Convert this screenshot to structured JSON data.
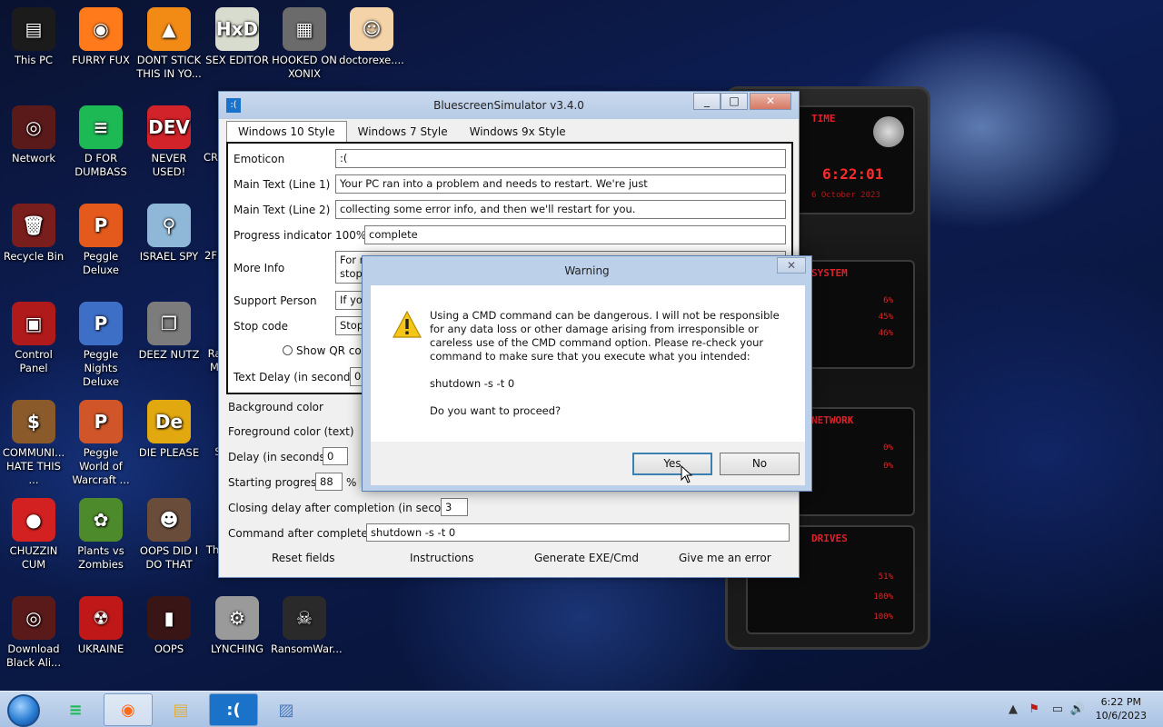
{
  "desktop": {
    "icons": [
      {
        "label": "This PC",
        "bg": "#1b1b1b",
        "glyph": "▤"
      },
      {
        "label": "FURRY FUX",
        "bg": "#ff7a1a",
        "glyph": "◉"
      },
      {
        "label": "DONT STICK THIS IN YO...",
        "bg": "#f28a16",
        "glyph": "▲"
      },
      {
        "label": "SEX EDITOR",
        "bg": "#d8dccf",
        "glyph": "HxD"
      },
      {
        "label": "HOOKED ON XONIX",
        "bg": "#6b6b6b",
        "glyph": "▦"
      },
      {
        "label": "doctorexe....",
        "bg": "#f4d3a8",
        "glyph": "☺"
      },
      {
        "label": "Network",
        "bg": "#5a1a1a",
        "glyph": "◎"
      },
      {
        "label": "D FOR DUMBASS",
        "bg": "#1db954",
        "glyph": "≡"
      },
      {
        "label": "NEVER USED!",
        "bg": "#d3232a",
        "glyph": "DEV"
      },
      {
        "label": "Recycle Bin",
        "bg": "#7a1d1d",
        "glyph": "🗑"
      },
      {
        "label": "Peggle Deluxe",
        "bg": "#e45a1c",
        "glyph": "P"
      },
      {
        "label": "ISRAEL SPY",
        "bg": "#8fb8d8",
        "glyph": "⚲"
      },
      {
        "label": "Control Panel",
        "bg": "#b01a1a",
        "glyph": "▣"
      },
      {
        "label": "Peggle Nights Deluxe",
        "bg": "#3d6fc7",
        "glyph": "P"
      },
      {
        "label": "DEEZ NUTZ",
        "bg": "#7c7c7c",
        "glyph": "❐"
      },
      {
        "label": "COMMUNI... HATE THIS ...",
        "bg": "#8a5a2a",
        "glyph": "$"
      },
      {
        "label": "Peggle World of Warcraft ...",
        "bg": "#d0562a",
        "glyph": "P"
      },
      {
        "label": "DIE PLEASE",
        "bg": "#e2a80f",
        "glyph": "De"
      },
      {
        "label": "CHUZZIN CUM",
        "bg": "#d32020",
        "glyph": "●"
      },
      {
        "label": "Plants vs Zombies",
        "bg": "#4d8a2c",
        "glyph": "✿"
      },
      {
        "label": "OOPS DID I DO THAT",
        "bg": "#6a4c3a",
        "glyph": "☻"
      },
      {
        "label": "Download Black Ali...",
        "bg": "#5a1a1a",
        "glyph": "◎"
      },
      {
        "label": "UKRAINE",
        "bg": "#c01818",
        "glyph": "☢"
      },
      {
        "label": "OOPS",
        "bg": "#3a1515",
        "glyph": "▮"
      },
      {
        "label": "LYNCHING",
        "bg": "#9a9a9a",
        "glyph": "⚙"
      },
      {
        "label": "RansomWar...",
        "bg": "#2a2a2a",
        "glyph": "☠"
      }
    ],
    "partial_labels": [
      "CR",
      "2F",
      "Ra M",
      "S",
      "Th"
    ]
  },
  "skin": {
    "panels": [
      {
        "title": "TIME",
        "value": "6:22:01",
        "sub": "6 October 2023"
      },
      {
        "title": "SYSTEM",
        "pcts": [
          "6%",
          "45%",
          "46%"
        ]
      },
      {
        "title": "NETWORK",
        "pcts": [
          "0%",
          "0%"
        ]
      },
      {
        "title": "DRIVES",
        "pcts": [
          "51%",
          "100%",
          "100%"
        ]
      }
    ]
  },
  "app": {
    "title": "BluescreenSimulator v3.4.0",
    "icon_text": ":(",
    "controls": {
      "minimize": "_",
      "maximize": "□",
      "close": "✕"
    },
    "tabs": [
      "Windows 10 Style",
      "Windows 7 Style",
      "Windows 9x Style"
    ],
    "fields": {
      "emoticon_label": "Emoticon",
      "emoticon_value": ":(",
      "main1_label": "Main Text (Line 1)",
      "main1_value": "Your PC ran into a problem and needs to restart. We're just",
      "main2_label": "Main Text (Line 2)",
      "main2_value": "collecting some error info, and then we'll restart for you.",
      "progress_label": "Progress indicator",
      "progress_pct": "100%",
      "progress_value": "complete",
      "moreinfo_label": "More Info",
      "moreinfo_value_l1": "For m",
      "moreinfo_value_l2": "stopc",
      "support_label": "Support Person",
      "support_value": "If you",
      "stopcode_label": "Stop code",
      "stopcode_value": "Stop",
      "qr_label": "Show QR code",
      "textdelay_label": "Text Delay (in seconds)",
      "textdelay_value": "0"
    },
    "lower": {
      "bg_label": "Background color",
      "fg_label": "Foreground color (text)",
      "delay_label": "Delay (in seconds)",
      "delay_value": "0",
      "startprog_label": "Starting progress",
      "startprog_value": "88",
      "startprog_unit": "%",
      "closing_label": "Closing delay after completion (in seconds)",
      "closing_value": "3",
      "command_label": "Command after complete",
      "command_value": "shutdown -s -t 0"
    },
    "footer": [
      "Reset fields",
      "Instructions",
      "Generate EXE/Cmd",
      "Give me an error"
    ]
  },
  "dialog": {
    "title": "Warning",
    "close": "✕",
    "message": "Using a CMD command can be dangerous. I will not be responsible for any data loss or other damage arising from irresponsible or careless use of the CMD command option. Please re-check your command to make sure that you execute what you intended:",
    "command": "shutdown -s -t 0",
    "question": "Do you want to proceed?",
    "yes": "Yes",
    "no": "No"
  },
  "taskbar": {
    "items": [
      {
        "name": "spotify",
        "glyph": "≡",
        "color": "#1db954"
      },
      {
        "name": "firefox",
        "glyph": "◉",
        "color": "#ff6a1a"
      },
      {
        "name": "explorer",
        "glyph": "▤",
        "color": "#e0b040"
      },
      {
        "name": "bluescreensimulator",
        "glyph": ":(",
        "color": "#ffffff"
      },
      {
        "name": "taskmanager",
        "glyph": "▨",
        "color": "#4a7ab8"
      }
    ],
    "time": "6:22 PM",
    "date": "10/6/2023",
    "tray_icons": [
      "▲",
      "⚑",
      "▭",
      "🔊"
    ]
  },
  "colors": {
    "accent": "#3c7fb1",
    "titlebar": "#b7cbe6",
    "skin_red": "#e0202a"
  }
}
